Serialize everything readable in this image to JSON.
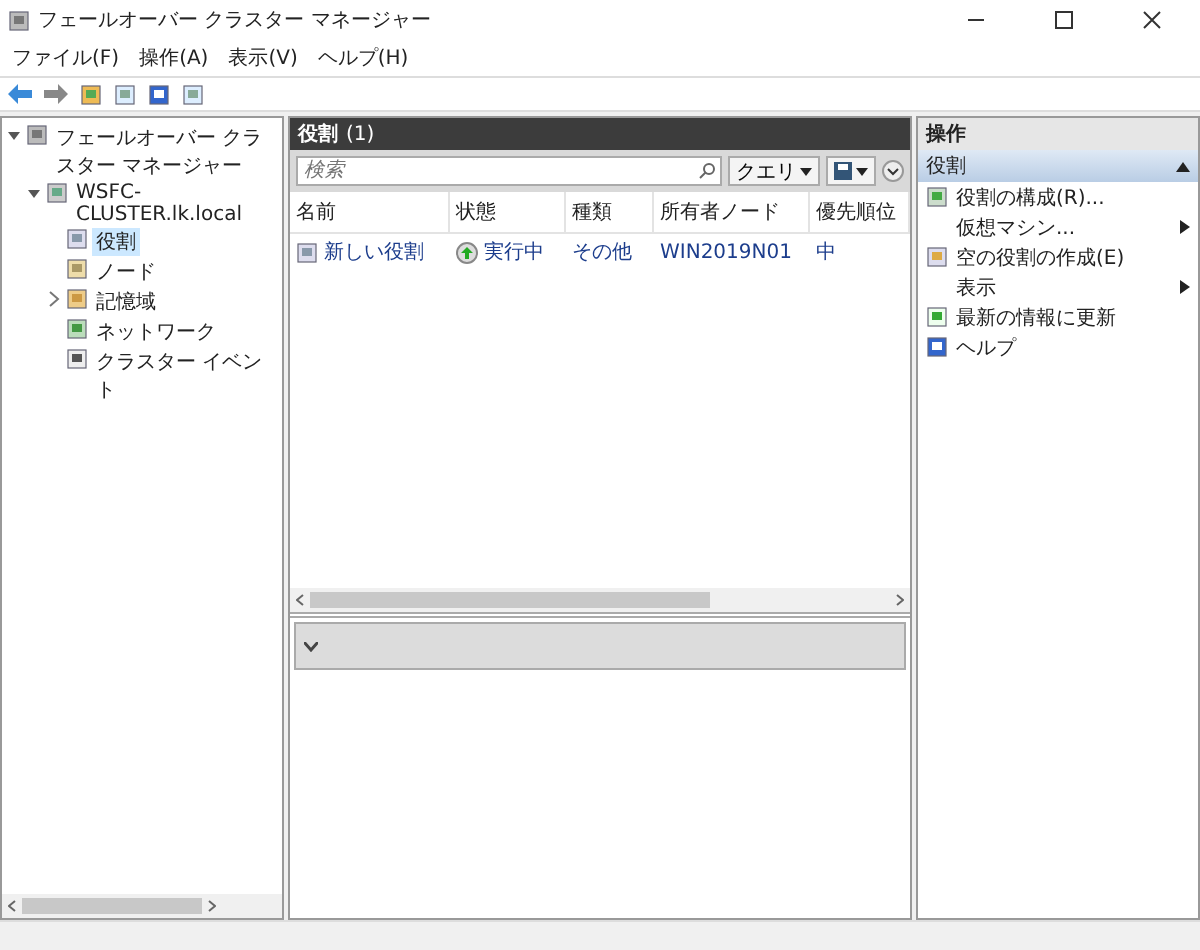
{
  "window": {
    "title": "フェールオーバー クラスター マネージャー"
  },
  "menu": [
    "ファイル(F)",
    "操作(A)",
    "表示(V)",
    "ヘルプ(H)"
  ],
  "tree": [
    {
      "label": "フェールオーバー クラスター マネージャー",
      "expanded": true,
      "selected": false,
      "children": [
        {
          "label": "WSFC-CLUSTER.lk.local",
          "expanded": true,
          "selected": false,
          "children": [
            {
              "label": "役割",
              "selected": true
            },
            {
              "label": "ノード",
              "selected": false
            },
            {
              "label": "記憶域",
              "expanded": false,
              "selected": false
            },
            {
              "label": "ネットワーク",
              "selected": false
            },
            {
              "label": "クラスター イベント",
              "selected": false
            }
          ]
        }
      ]
    }
  ],
  "center": {
    "title": "役割",
    "count": "(1)",
    "search": {
      "placeholder": "検索"
    },
    "query_button": "クエリ",
    "columns": [
      "名前",
      "状態",
      "種類",
      "所有者ノード",
      "優先順位"
    ],
    "rows": [
      {
        "cells": [
          "新しい役割",
          "実行中",
          "その他",
          "WIN2019N01",
          "中"
        ],
        "selected": false
      }
    ]
  },
  "actions": {
    "title": "操作",
    "section": {
      "label": "役割",
      "expanded": true
    },
    "items": [
      {
        "label": "役割の構成(R)...",
        "kind": "action"
      },
      {
        "label": "仮想マシン...",
        "kind": "submenu"
      },
      {
        "label": "空の役割の作成(E)",
        "kind": "action"
      },
      {
        "label": "表示",
        "kind": "submenu"
      },
      {
        "label": "最新の情報に更新",
        "kind": "action"
      },
      {
        "label": "ヘルプ",
        "kind": "action"
      }
    ]
  }
}
